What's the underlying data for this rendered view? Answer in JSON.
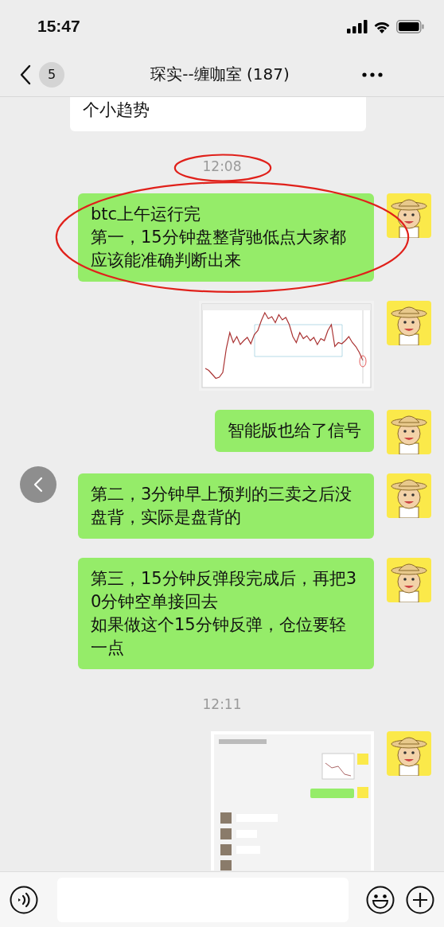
{
  "status_bar": {
    "time": "15:47"
  },
  "nav": {
    "unread_count": "5",
    "title": "琛实--缠咖室 (187)"
  },
  "messages": [
    {
      "kind": "text",
      "outgoing": false,
      "clipped": true,
      "lines": [
        "个小趋势"
      ]
    },
    {
      "kind": "time",
      "text": "12:08",
      "circled": true
    },
    {
      "kind": "text",
      "outgoing": true,
      "circled": true,
      "lines": [
        "btc上午运行完",
        "第一，15分钟盘整背驰低点大家都应该能准确判断出来"
      ]
    },
    {
      "kind": "chart_image",
      "outgoing": true
    },
    {
      "kind": "text",
      "outgoing": true,
      "lines": [
        "智能版也给了信号"
      ]
    },
    {
      "kind": "text",
      "outgoing": true,
      "lines": [
        "第二，3分钟早上预判的三卖之后没盘背，实际是盘背的"
      ]
    },
    {
      "kind": "text",
      "outgoing": true,
      "lines": [
        "第三，15分钟反弹段完成后，再把30分钟空单接回去",
        "如果做这个15分钟反弹，仓位要轻一点"
      ]
    },
    {
      "kind": "time",
      "text": "12:11"
    },
    {
      "kind": "screenshot_image",
      "outgoing": true
    }
  ]
}
